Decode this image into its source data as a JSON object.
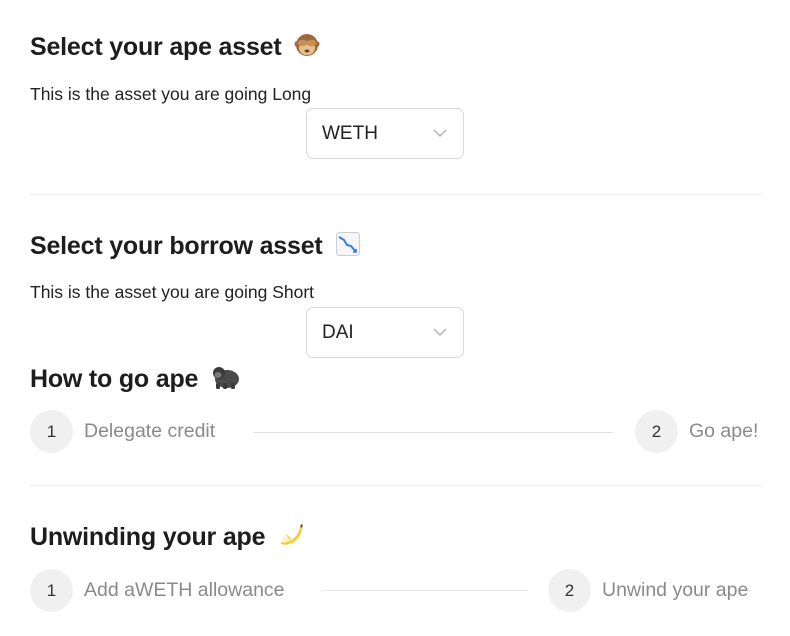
{
  "ape_asset": {
    "title": "Select your ape asset",
    "subtitle": "This is the asset you are going Long",
    "selected": "WETH"
  },
  "borrow_asset": {
    "title": "Select your borrow asset",
    "subtitle": "This is the asset you are going Short",
    "selected": "DAI"
  },
  "go_ape": {
    "title": "How to go ape",
    "steps": [
      {
        "number": "1",
        "label": "Delegate credit"
      },
      {
        "number": "2",
        "label": "Go ape!"
      }
    ]
  },
  "unwind": {
    "title": "Unwinding your ape",
    "steps": [
      {
        "number": "1",
        "label": "Add aWETH allowance"
      },
      {
        "number": "2",
        "label": "Unwind your ape"
      }
    ]
  },
  "icons": {
    "ape_asset": "see-no-evil-monkey-icon",
    "borrow_asset": "chart-decreasing-icon",
    "go_ape": "gorilla-icon",
    "unwind": "banana-icon",
    "select": "chevron-down-icon"
  }
}
